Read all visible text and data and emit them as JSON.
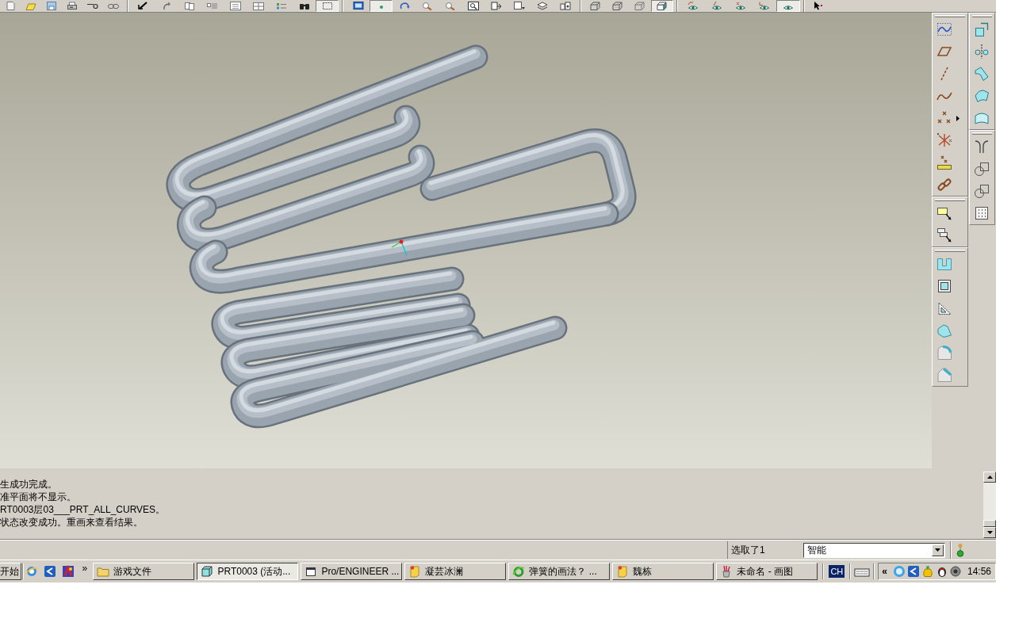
{
  "toolbar": {
    "groups": [
      [
        {
          "pressed": false
        },
        {
          "pressed": false
        },
        {
          "pressed": false
        },
        {
          "pressed": false
        },
        {
          "pressed": false
        },
        {
          "pressed": false
        }
      ],
      [
        {
          "pressed": false
        },
        {
          "pressed": false
        },
        {
          "pressed": false
        },
        {
          "pressed": false
        },
        {
          "pressed": false
        },
        {
          "pressed": false
        },
        {
          "pressed": false
        },
        {
          "pressed": false
        },
        {
          "pressed": true
        }
      ],
      [
        {
          "pressed": false
        },
        {
          "pressed": true
        },
        {
          "pressed": false
        },
        {
          "pressed": false
        },
        {
          "pressed": false
        },
        {
          "pressed": false
        },
        {
          "pressed": false
        },
        {
          "pressed": false
        },
        {
          "pressed": false
        },
        {
          "pressed": false
        }
      ],
      [
        {
          "pressed": false
        },
        {
          "pressed": false
        },
        {
          "pressed": false
        },
        {
          "pressed": true
        }
      ],
      [
        {
          "pressed": false
        },
        {
          "pressed": false
        },
        {
          "pressed": false
        },
        {
          "pressed": false
        },
        {
          "pressed": true
        }
      ],
      [
        {
          "pressed": false
        }
      ]
    ]
  },
  "messages": {
    "lines": [
      "生成功完成。",
      "准平面将不显示。",
      "RT0003层03___PRT_ALL_CURVES。",
      "状态改变成功。重画来查看结果。"
    ]
  },
  "status_bar": {
    "selection": "选取了1",
    "filter": {
      "value": "智能"
    }
  },
  "taskbar": {
    "start": "开始",
    "more": "»",
    "tasks": [
      {
        "label": "游戏文件",
        "selected": false
      },
      {
        "label": "PRT0003 (活动...",
        "selected": true
      },
      {
        "label": "Pro/ENGINEER ...",
        "selected": false
      },
      {
        "label": "凝芸冰澜",
        "selected": false
      },
      {
        "label": "弹簧的画法？ ...",
        "selected": false
      },
      {
        "label": "魏栋",
        "selected": false
      },
      {
        "label": "未命名 - 画图",
        "selected": false
      }
    ],
    "language": "CH",
    "tray": {
      "expand": "«",
      "clock": "14:56"
    }
  }
}
